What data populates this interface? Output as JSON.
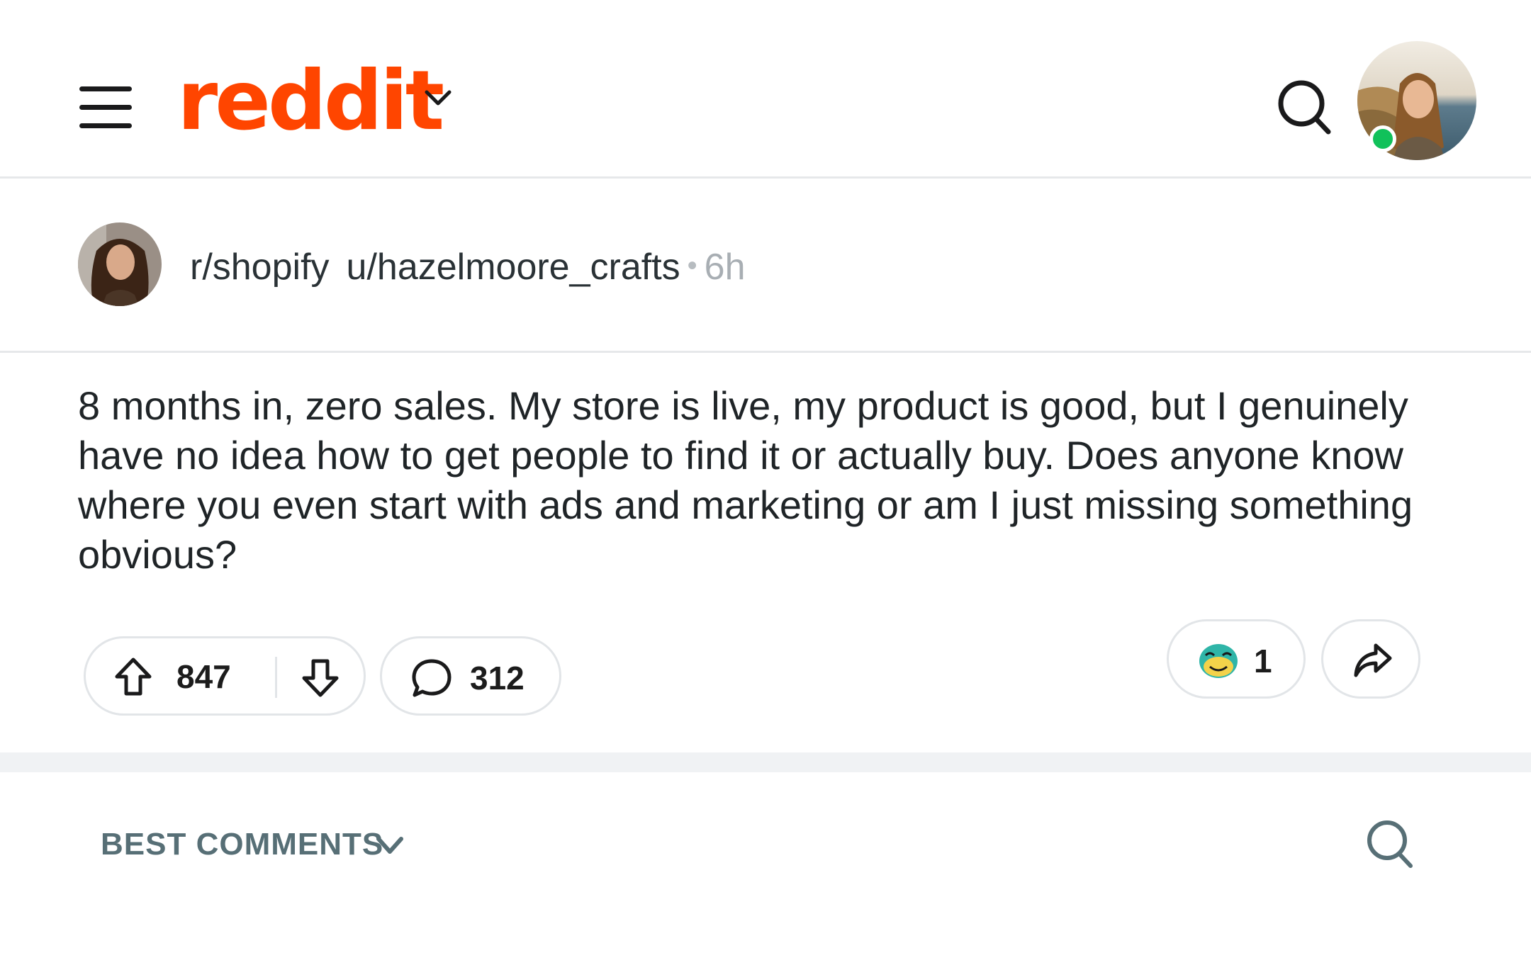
{
  "header": {
    "logo_text": "reddit",
    "brand_color": "#ff4500",
    "icons": [
      "hamburger-menu-icon",
      "chevron-down-icon",
      "search-icon",
      "user-avatar"
    ],
    "online_status_color": "#11c15a"
  },
  "post": {
    "subreddit": "r/shopify",
    "author": "u/hazelmoore_crafts",
    "separator": "•",
    "age": "6h",
    "body": "8 months in, zero sales. My store is live, my product is good, but I genuinely have no idea how to get people to find it or actually buy. Does anyone know where you even start with ads and marketing or am I just missing something obvious?",
    "score": "847",
    "comment_count": "312",
    "award_count": "1"
  },
  "comments_section": {
    "sort_label": "BEST COMMENTS"
  }
}
